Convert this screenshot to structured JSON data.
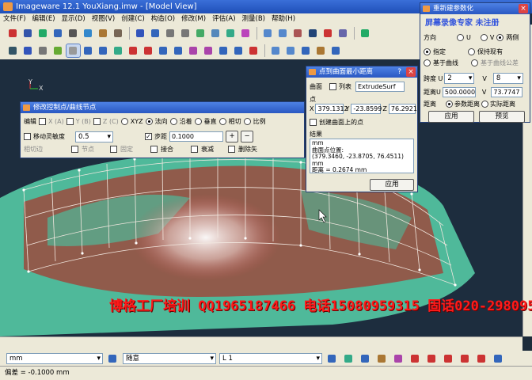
{
  "app": {
    "title": "Imageware 12.1   YouXiang.imw - [Model View]"
  },
  "menu": [
    "文件(F)",
    "编辑(E)",
    "显示(D)",
    "视图(V)",
    "创建(C)",
    "构造(O)",
    "修改(M)",
    "评估(A)",
    "测量(B)",
    "帮助(H)"
  ],
  "control_dialog": {
    "title": "修改控制点/曲线节点",
    "edit_label": "编辑",
    "axis": [
      "X (A)",
      "Y (B)",
      "Z (C)"
    ],
    "dir_options": [
      "XYZ",
      "法向",
      "沿着",
      "垂直",
      "相切",
      "比例"
    ],
    "move_sensitivity_label": "移动灵敏度",
    "move_sensitivity_value": "0.5",
    "step_label": "步距",
    "step_value": "0.1000",
    "plus": "+",
    "minus": "−",
    "row3": [
      "相切边",
      "节点",
      "固定",
      "接合",
      "衰减",
      "删除矢"
    ]
  },
  "dist_dialog": {
    "title": "点到曲面最小距离",
    "surface_label": "曲面",
    "list_label": "列表",
    "surface_value": "ExtrudeSurf",
    "point_label": "点",
    "x_label": "X",
    "x_value": "379.1312",
    "y_label": "Y",
    "y_value": "-23.8599",
    "z_label": "Z",
    "z_value": "76.2921",
    "create_point_label": "创建曲面上的点",
    "result_label": "结果",
    "result_text": "mm\n曲面点位置:\n(379.3460, -23.8705, 76.4511)\nmm\n距离 = 0.2674 mm",
    "apply": "应用"
  },
  "reparam_dialog": {
    "title": "重新建参数化",
    "overlay_text": "屏幕录像专家 未注册",
    "direction_label": "方向",
    "dir_options": [
      "U",
      "V",
      "两侧"
    ],
    "specify_label": "指定",
    "keep_label": "保持现有",
    "based_curve_label": "基于曲线",
    "based_curve_tol_label": "基于曲线公差",
    "span_label": "跨度 U",
    "span_u": "2",
    "span_v_label": "V",
    "span_v": "8",
    "dist_label": "距离U",
    "dist_u": "500.0000",
    "dist_v_label": "V",
    "dist_v": "73.7747",
    "dist_type_label": "距离",
    "param_dist": "参数距离",
    "actual_dist": "实际距离",
    "apply": "应用",
    "preview": "预览"
  },
  "watermark": "博格工厂培训 QQ1965187466 电话15080959315 固话020-29809540",
  "bottom": {
    "unit": "mm",
    "mode": "随意",
    "line": "L 1"
  },
  "status": {
    "text": "偏差 = -0.1000 mm"
  },
  "axis_labels": {
    "y": "Y",
    "x": "X"
  },
  "colors": {
    "title_blue": "#2a58c2",
    "surface_green": "#4fb99a",
    "patch_red": "#a53a33"
  }
}
